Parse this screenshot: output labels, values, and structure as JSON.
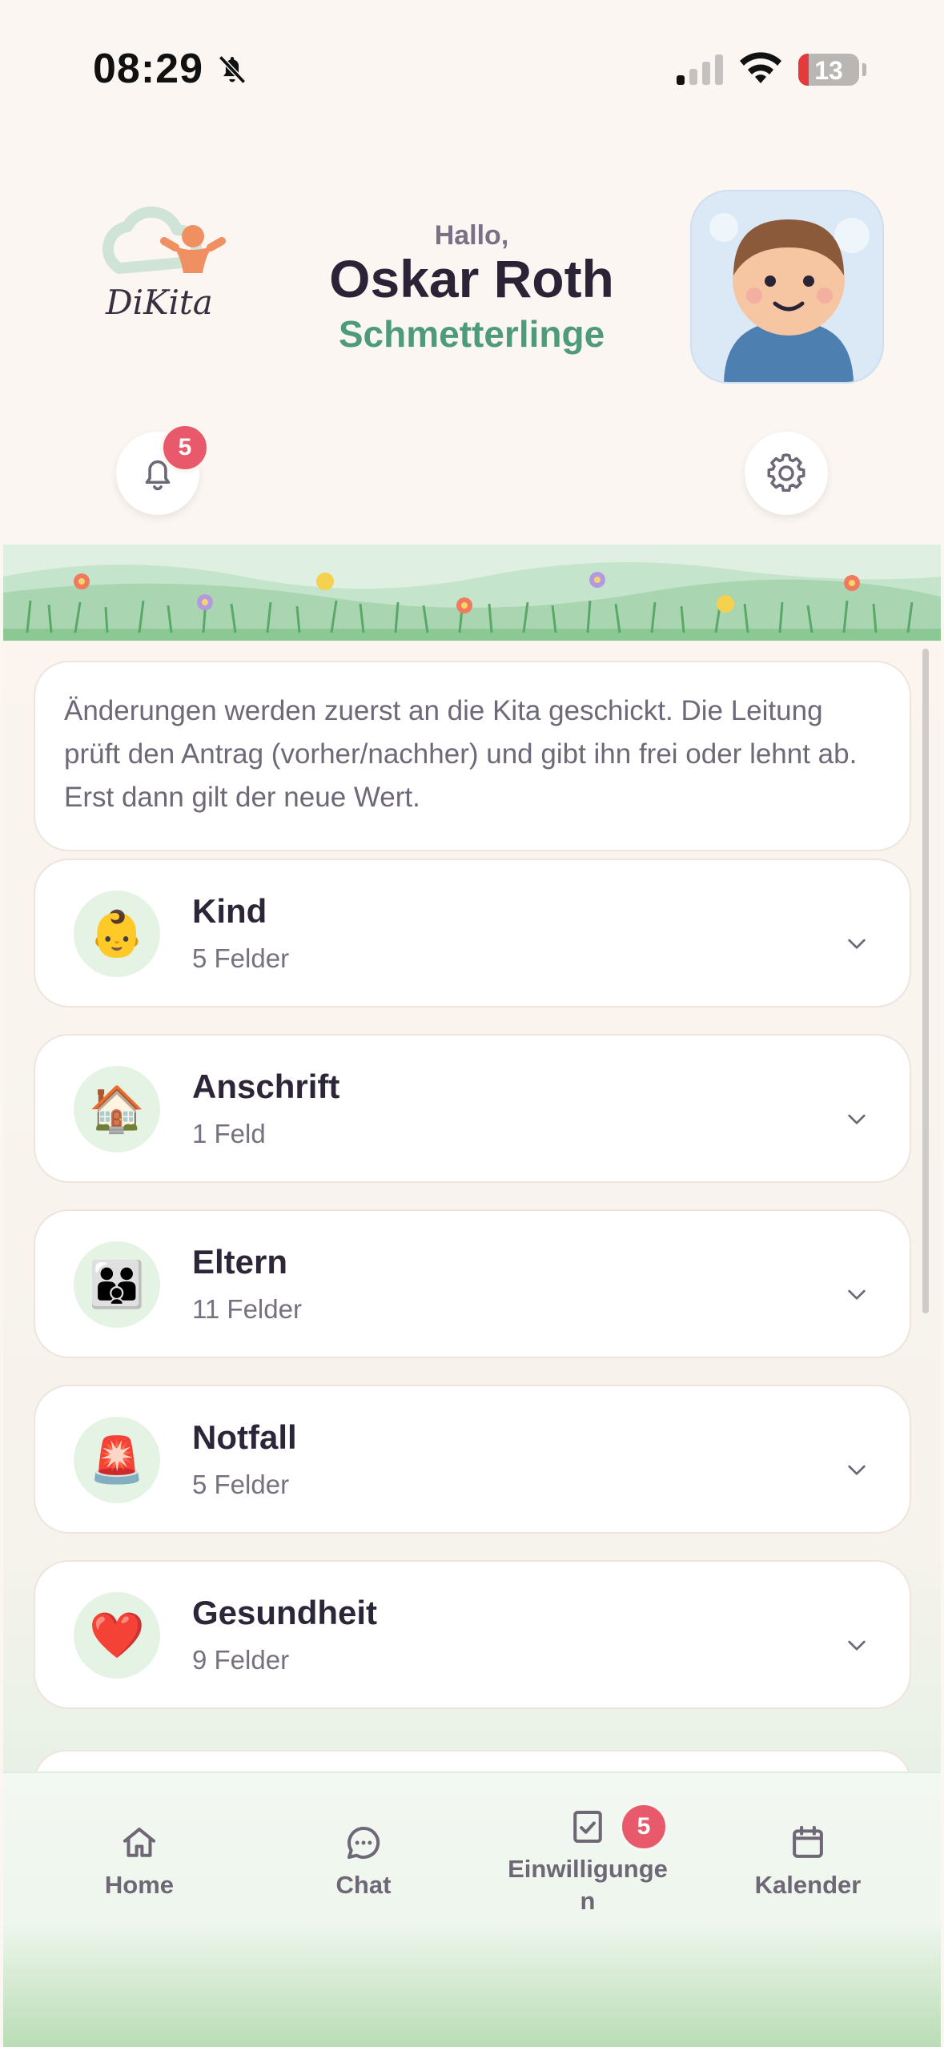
{
  "status_bar": {
    "time": "08:29",
    "battery": "13"
  },
  "header": {
    "logo_text": "DiKita",
    "greeting": "Hallo,",
    "user_name": "Oskar Roth",
    "group_name": "Schmetterlinge",
    "notification_count": "5"
  },
  "info_text": "Änderungen werden zuerst an die Kita geschickt. Die Leitung prüft den Antrag (vorher/nachher) und gibt ihn frei oder lehnt ab. Erst dann gilt der neue Wert.",
  "sections": [
    {
      "icon": "👶",
      "title": "Kind",
      "subtitle": "5 Felder"
    },
    {
      "icon": "🏠",
      "title": "Anschrift",
      "subtitle": "1 Feld"
    },
    {
      "icon": "👪",
      "title": "Eltern",
      "subtitle": "11 Felder"
    },
    {
      "icon": "🚨",
      "title": "Notfall",
      "subtitle": "5 Felder"
    },
    {
      "icon": "❤️",
      "title": "Gesundheit",
      "subtitle": "9 Felder"
    }
  ],
  "nav": {
    "home": "Home",
    "chat": "Chat",
    "consents": "Einwilligunge\nn",
    "calendar": "Kalender",
    "consents_badge": "5"
  },
  "colors": {
    "accent_green": "#4d9b78",
    "badge_red": "#e85a6b",
    "background": "#fcf6f2"
  }
}
